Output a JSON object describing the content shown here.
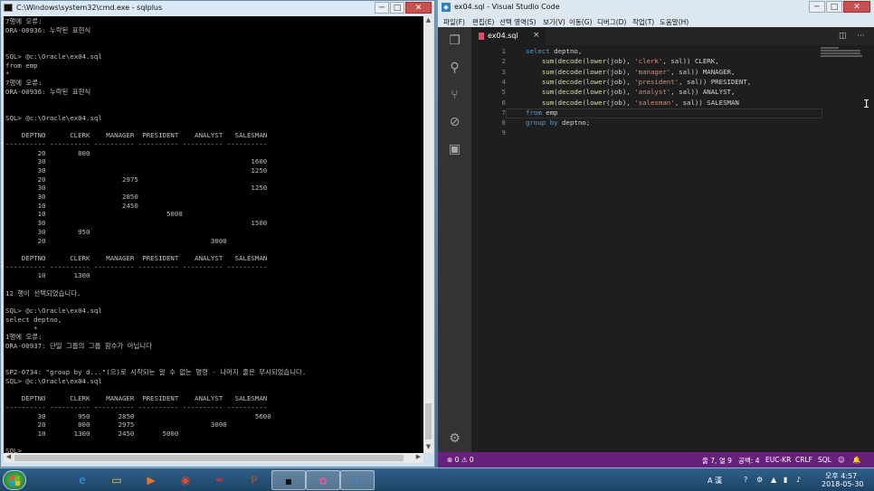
{
  "cmd": {
    "title": "C:\\Windows\\system32\\cmd.exe - sqlplus",
    "controls": {
      "minimize": "─",
      "maximize": "□",
      "close": "✕"
    },
    "console_lines": [
      "7행에 오류:",
      "ORA-00936: 누락된 표현식",
      "",
      "",
      "SQL> @c:\\Oracle\\ex04.sql",
      "from emp",
      "*",
      "7행에 오류:",
      "ORA-00936: 누락된 표현식",
      "",
      "",
      "SQL> @c:\\Oracle\\ex04.sql",
      "",
      "    DEPTNO      CLERK    MANAGER  PRESIDENT    ANALYST   SALESMAN",
      "---------- ---------- ---------- ---------- ---------- ----------",
      "        20        800",
      "        30                                                   1600",
      "        30                                                   1250",
      "        20                   2975",
      "        30                                                   1250",
      "        30                   2850",
      "        10                   2450",
      "        10                              5000",
      "        30                                                   1500",
      "        30        950",
      "        20                                         3000",
      "",
      "    DEPTNO      CLERK    MANAGER  PRESIDENT    ANALYST   SALESMAN",
      "---------- ---------- ---------- ---------- ---------- ----------",
      "        10       1300",
      "",
      "12 행이 선택되었습니다.",
      "",
      "SQL> @c:\\Oracle\\ex04.sql",
      "select deptno,",
      "       *",
      "1행에 오류:",
      "ORA-00937: 단일 그룹의 그룹 함수가 아닙니다",
      "",
      "",
      "SP2-0734: \"group by d...\"(으)로 시작되는 알 수 없는 명령 - 나머지 줄은 무시되었습니다.",
      "SQL> @c:\\Oracle\\ex04.sql",
      "",
      "    DEPTNO      CLERK    MANAGER  PRESIDENT    ANALYST   SALESMAN",
      "---------- ---------- ---------- ---------- ---------- ----------",
      "        30        950       2850                              5600",
      "        20        800       2975                   3000",
      "        10       1300       2450       5000",
      "",
      "SQL>"
    ]
  },
  "vscode": {
    "title": "ex04.sql - Visual Studio Code",
    "controls": {
      "minimize": "─",
      "maximize": "□",
      "close": "✕"
    },
    "menu": [
      "파일(F)",
      "편집(E)",
      "선택 영역(S)",
      "보기(V)",
      "이동(G)",
      "디버그(D)",
      "작업(T)",
      "도움말(H)"
    ],
    "activity_icons": [
      "files-icon",
      "search-icon",
      "source-control-icon",
      "debug-icon",
      "extensions-icon"
    ],
    "tab": {
      "label": "ex04.sql",
      "close": "×"
    },
    "tab_actions": {
      "split": "◫",
      "more": "···"
    },
    "line_numbers": [
      "1",
      "2",
      "3",
      "4",
      "5",
      "6",
      "7",
      "8",
      "9"
    ],
    "code_lines": [
      [
        {
          "t": "k",
          "v": "select"
        },
        {
          "t": "p",
          "v": " deptno,"
        }
      ],
      [
        {
          "t": "p",
          "v": "    "
        },
        {
          "t": "f",
          "v": "sum"
        },
        {
          "t": "p",
          "v": "("
        },
        {
          "t": "f",
          "v": "decode"
        },
        {
          "t": "p",
          "v": "("
        },
        {
          "t": "f",
          "v": "lower"
        },
        {
          "t": "p",
          "v": "(job), "
        },
        {
          "t": "s",
          "v": "'clerk'"
        },
        {
          "t": "p",
          "v": ", sal)) CLERK,"
        }
      ],
      [
        {
          "t": "p",
          "v": "    "
        },
        {
          "t": "f",
          "v": "sum"
        },
        {
          "t": "p",
          "v": "("
        },
        {
          "t": "f",
          "v": "decode"
        },
        {
          "t": "p",
          "v": "("
        },
        {
          "t": "f",
          "v": "lower"
        },
        {
          "t": "p",
          "v": "(job), "
        },
        {
          "t": "s",
          "v": "'manager'"
        },
        {
          "t": "p",
          "v": ", sal)) MANAGER,"
        }
      ],
      [
        {
          "t": "p",
          "v": "    "
        },
        {
          "t": "f",
          "v": "sum"
        },
        {
          "t": "p",
          "v": "("
        },
        {
          "t": "f",
          "v": "decode"
        },
        {
          "t": "p",
          "v": "("
        },
        {
          "t": "f",
          "v": "lower"
        },
        {
          "t": "p",
          "v": "(job), "
        },
        {
          "t": "s",
          "v": "'president'"
        },
        {
          "t": "p",
          "v": ", sal)) PRESIDENT,"
        }
      ],
      [
        {
          "t": "p",
          "v": "    "
        },
        {
          "t": "f",
          "v": "sum"
        },
        {
          "t": "p",
          "v": "("
        },
        {
          "t": "f",
          "v": "decode"
        },
        {
          "t": "p",
          "v": "("
        },
        {
          "t": "f",
          "v": "lower"
        },
        {
          "t": "p",
          "v": "(job), "
        },
        {
          "t": "s",
          "v": "'analyst'"
        },
        {
          "t": "p",
          "v": ", sal)) ANALYST,"
        }
      ],
      [
        {
          "t": "p",
          "v": "    "
        },
        {
          "t": "f",
          "v": "sum"
        },
        {
          "t": "p",
          "v": "("
        },
        {
          "t": "f",
          "v": "decode"
        },
        {
          "t": "p",
          "v": "("
        },
        {
          "t": "f",
          "v": "lower"
        },
        {
          "t": "p",
          "v": "(job), "
        },
        {
          "t": "s",
          "v": "'salesman'"
        },
        {
          "t": "p",
          "v": ", sal)) SALESMAN"
        }
      ],
      [
        {
          "t": "k",
          "v": "from"
        },
        {
          "t": "p",
          "v": " emp"
        }
      ],
      [
        {
          "t": "k",
          "v": "group by"
        },
        {
          "t": "p",
          "v": " deptno;"
        }
      ],
      []
    ],
    "status": {
      "problems": "⊗ 0 ⚠ 0",
      "position": "줄 7, 열 9",
      "spaces": "공백: 4",
      "encoding": "EUC-KR",
      "eol": "CRLF",
      "language": "SQL",
      "feedback": "☺",
      "notifications": "🔔"
    },
    "settings_icon": "⚙"
  },
  "taskbar": {
    "apps": [
      {
        "name": "internet-explorer-icon",
        "glyph": "e",
        "color": "#3a9be0"
      },
      {
        "name": "file-explorer-icon",
        "glyph": "▭",
        "color": "#f2c75c"
      },
      {
        "name": "media-player-icon",
        "glyph": "▶",
        "color": "#e8742c"
      },
      {
        "name": "chrome-icon",
        "glyph": "◉",
        "color": "#e04a3a"
      },
      {
        "name": "acrobat-icon",
        "glyph": "✒",
        "color": "#d83030"
      },
      {
        "name": "powerpoint-icon",
        "glyph": "P",
        "color": "#d24726"
      },
      {
        "name": "cmd-icon",
        "glyph": "▪",
        "color": "#111111"
      },
      {
        "name": "paint-icon",
        "glyph": "✿",
        "color": "#e05a9a"
      },
      {
        "name": "vscode-icon",
        "glyph": "⟨⟩",
        "color": "#2f7fd1"
      }
    ],
    "tray": {
      "ime": "A 漢",
      "time": "오후 4:57",
      "date": "2018-05-30"
    }
  }
}
